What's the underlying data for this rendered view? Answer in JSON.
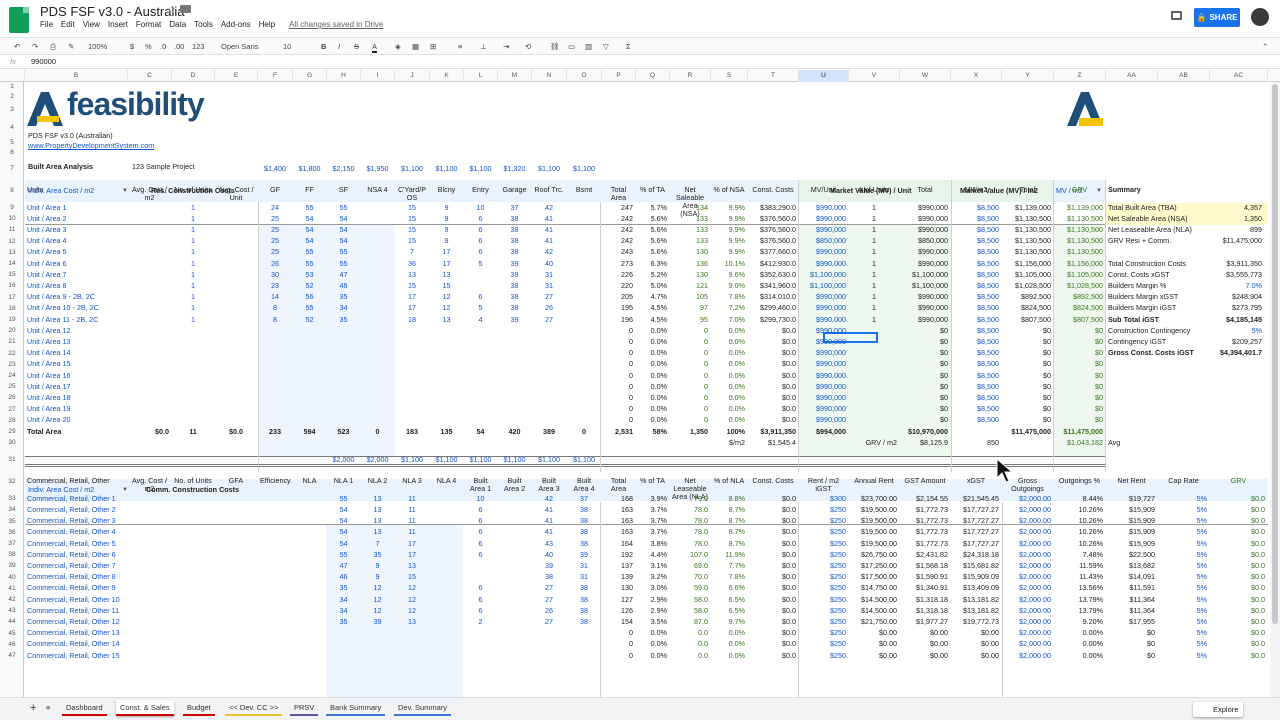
{
  "app": {
    "title": "PDS FSF v3.0 - Australia",
    "saved": "All changes saved in Drive",
    "share": "SHARE",
    "menus": [
      "File",
      "Edit",
      "View",
      "Insert",
      "Format",
      "Data",
      "Tools",
      "Add-ons",
      "Help"
    ]
  },
  "toolbar": {
    "zoom": "100%",
    "currency": "$",
    "percent": "%",
    "dec0": ".0",
    "dec00": ".00",
    "fmt": "123",
    "font": "Open Sans",
    "size": "10"
  },
  "formula": {
    "fx": "fx",
    "value": "990000"
  },
  "columns": [
    "",
    "B",
    "C",
    "D",
    "E",
    "F",
    "G",
    "H",
    "I",
    "J",
    "K",
    "L",
    "M",
    "N",
    "O",
    "P",
    "Q",
    "R",
    "S",
    "T",
    "U",
    "V",
    "W",
    "X",
    "Y",
    "Z",
    "AA",
    "AB",
    "AC"
  ],
  "rows": [
    "1",
    "2",
    "3",
    "4",
    "5",
    "6",
    "7",
    "8",
    "9",
    "10",
    "11",
    "12",
    "13",
    "14",
    "15",
    "16",
    "17",
    "18",
    "19",
    "20",
    "21",
    "22",
    "23",
    "24",
    "25",
    "26",
    "27",
    "28",
    "29",
    "30",
    "31",
    "32",
    "33",
    "34",
    "35",
    "36",
    "37",
    "38",
    "39",
    "40",
    "41",
    "42",
    "43",
    "44",
    "45",
    "46",
    "47"
  ],
  "header": {
    "logo_text": "feasibility",
    "subtitle": "PDS FSF v3.0 (Australian)",
    "link": "www.PropertyDevelopmentSystem.com",
    "analysis": "Built Area Analysis",
    "project": "123 Sample Project"
  },
  "row7": {
    "indiv": "Indiv. Area Cost / m2",
    "res": "Res. Construction Costs",
    "rates": [
      "$1,400",
      "$1,800",
      "$2,150",
      "$1,950",
      "$1,100",
      "$1,100",
      "$1,100",
      "$1,320",
      "$1,100",
      "$1,100"
    ],
    "mvunit": "Market Value (MV) / Unit",
    "mvm2": "Market Value (MV) / m2",
    "mvm2b": "MV / m2"
  },
  "row8": [
    "Units",
    "Avg. Cost / m2",
    "No. of Units",
    "Avg. Cost / Unit",
    "GF",
    "FF",
    "SF",
    "NSA 4",
    "C'Yard/P OS",
    "Blcny",
    "Entry",
    "Garage",
    "Roof Trc.",
    "Bsmt",
    "Total Area",
    "% of TA",
    "Net Saleable Area (NSA)",
    "% of NSA",
    "Const. Costs",
    "MV/Unit",
    "# of Units",
    "Total",
    "MV/m2",
    "Total",
    "GRV",
    "Summary"
  ],
  "units": [
    [
      "Unit / Area 1",
      "1",
      "24",
      "55",
      "55",
      "",
      "15",
      "9",
      "10",
      "37",
      "42",
      "",
      "247",
      "5.7%",
      "134",
      "9.9%",
      "$383,290.0",
      "$990,000",
      "1",
      "$990,000",
      "$8,500",
      "$1,139,000",
      "$1,139,000"
    ],
    [
      "Unit / Area 2",
      "1",
      "25",
      "54",
      "54",
      "",
      "15",
      "9",
      "6",
      "38",
      "41",
      "",
      "242",
      "5.6%",
      "133",
      "9.9%",
      "$376,560.0",
      "$990,000",
      "1",
      "$990,000",
      "$8,500",
      "$1,130,500",
      "$1,130,500"
    ],
    [
      "Unit / Area 3",
      "1",
      "25",
      "54",
      "54",
      "",
      "15",
      "9",
      "6",
      "38",
      "41",
      "",
      "242",
      "5.6%",
      "133",
      "9.9%",
      "$376,560.0",
      "$990,000",
      "1",
      "$990,000",
      "$8,500",
      "$1,130,500",
      "$1,130,500"
    ],
    [
      "Unit / Area 4",
      "1",
      "25",
      "54",
      "54",
      "",
      "15",
      "9",
      "6",
      "38",
      "41",
      "",
      "242",
      "5.6%",
      "133",
      "9.9%",
      "$376,560.0",
      "$850,000",
      "1",
      "$850,000",
      "$8,500",
      "$1,130,500",
      "$1,130,500"
    ],
    [
      "Unit / Area 5",
      "1",
      "25",
      "55",
      "55",
      "",
      "7",
      "17",
      "6",
      "38",
      "42",
      "",
      "243",
      "5.6%",
      "130",
      "9.9%",
      "$377,660.0",
      "$990,000",
      "1",
      "$990,000",
      "$8,500",
      "$1,130,500",
      "$1,130,500"
    ],
    [
      "Unit / Area 6",
      "1",
      "26",
      "55",
      "55",
      "",
      "36",
      "17",
      "5",
      "39",
      "40",
      "",
      "273",
      "6.3%",
      "136",
      "10.1%",
      "$412,930.0",
      "$990,000",
      "1",
      "$990,000",
      "$8,500",
      "$1,156,000",
      "$1,156,000"
    ],
    [
      "Unit / Area 7",
      "1",
      "30",
      "53",
      "47",
      "",
      "13",
      "13",
      "",
      "39",
      "31",
      "",
      "226",
      "5.2%",
      "130",
      "9.6%",
      "$352,630.0",
      "$1,100,000",
      "1",
      "$1,100,000",
      "$8,500",
      "$1,105,000",
      "$1,105,000"
    ],
    [
      "Unit / Area 8",
      "1",
      "23",
      "52",
      "46",
      "",
      "15",
      "15",
      "",
      "38",
      "31",
      "",
      "220",
      "5.0%",
      "121",
      "9.0%",
      "$341,960.0",
      "$1,100,000",
      "1",
      "$1,100,000",
      "$8,500",
      "$1,028,500",
      "$1,028,500"
    ],
    [
      "Unit / Area 9 - 2B, 2C",
      "1",
      "14",
      "56",
      "35",
      "",
      "17",
      "12",
      "6",
      "38",
      "27",
      "",
      "205",
      "4.7%",
      "105",
      "7.8%",
      "$314,010.0",
      "$990,000",
      "1",
      "$990,000",
      "$8,500",
      "$892,500",
      "$892,500"
    ],
    [
      "Unit / Area 10 - 2B, 2C",
      "1",
      "8",
      "55",
      "34",
      "",
      "17",
      "12",
      "5",
      "38",
      "26",
      "",
      "195",
      "4.5%",
      "97",
      "7.2%",
      "$299,460.0",
      "$990,000",
      "1",
      "$990,000",
      "$8,500",
      "$824,500",
      "$824,500"
    ],
    [
      "Unit / Area 11 - 2B, 2C",
      "1",
      "8",
      "52",
      "35",
      "",
      "18",
      "13",
      "4",
      "39",
      "27",
      "",
      "196",
      "4.5%",
      "95",
      "7.0%",
      "$299,730.0",
      "$990,000",
      "1",
      "$990,000",
      "$8,500",
      "$807,500",
      "$807,500"
    ]
  ],
  "empty_units": [
    "Unit / Area 12",
    "Unit / Area 13",
    "Unit / Area 14",
    "Unit / Area 15",
    "Unit / Area 16",
    "Unit / Area 17",
    "Unit / Area 18",
    "Unit / Area 19",
    "Unit / Area 20"
  ],
  "empty_vals": {
    "ta": "0",
    "pct": "0.0%",
    "nsa": "0",
    "pnsa": "0.0%",
    "cc": "$0.0",
    "mv": "$990,000",
    "tot": "$0",
    "mvm2": "$8,500",
    "tot2": "$0",
    "grv": "$0"
  },
  "summary": [
    [
      "Total Built Area (TBA)",
      "4,357"
    ],
    [
      "Net Saleable Area (NSA)",
      "1,350"
    ],
    [
      "Net Leaseable Area (NLA)",
      "899"
    ],
    [
      "GRV Resi + Comm.",
      "$11,475,000"
    ],
    [
      "",
      ""
    ],
    [
      "Total Construction Costs",
      "$3,911,350"
    ],
    [
      "Const. Costs xGST",
      "$3,555,773"
    ],
    [
      "Builders Margin %",
      "7.0%"
    ],
    [
      "Builders Margin xGST",
      "$248,904"
    ],
    [
      "Builders Margin iGST",
      "$273,795"
    ],
    [
      "Sub Total iGST",
      "$4,185,145"
    ],
    [
      "Construction Contingency",
      "5%"
    ],
    [
      "Contingency iGST",
      "$209,257"
    ],
    [
      "Gross Const. Costs iGST",
      "$4,394,401.7"
    ]
  ],
  "totals": [
    "Total Area",
    "$0.0",
    "11",
    "$0.0",
    "233",
    "594",
    "523",
    "0",
    "183",
    "135",
    "54",
    "420",
    "389",
    "0",
    "2,531",
    "58%",
    "1,350",
    "100%",
    "$3,911,350",
    "$994,000",
    "",
    "$10,970,000",
    "",
    "$11,475,000",
    "$11,475,000"
  ],
  "row30": {
    "m2": "$/m2",
    "cpm": "$1,545.4",
    "grvm2": "GRV / m2",
    "grvm2val": "$8,125.9",
    "n850": "850",
    "grv2": "$1,043,182",
    "avg": "Avg"
  },
  "row31": {
    "indiv": "Indiv. Area Cost / m2",
    "comm": "Comm. Construction Costs",
    "rates": [
      "$2,000",
      "$2,000",
      "$1,100",
      "$1,100",
      "$1,100",
      "$1,100",
      "$1,100",
      "$1,100"
    ]
  },
  "row32": [
    "Commercial, Retail, Other",
    "Avg. Cost / m2",
    "No. of Units",
    "GFA",
    "Efficiency",
    "NLA",
    "NLA 1",
    "NLA 2",
    "NLA 3",
    "NLA 4",
    "Built Area 1",
    "Built Area 2",
    "Built Area 3",
    "Built Area 4",
    "Total Area",
    "% of TA",
    "Net Leaseable Area (NLA)",
    "% of NLA",
    "Const. Costs",
    "Rent / m2 iGST",
    "Annual Rent",
    "GST Amount",
    "xGST",
    "Gross Outgoings",
    "Outgoings %",
    "Net Rent",
    "Cap Rate",
    "GRV"
  ],
  "comm": [
    [
      "Commercial, Retail, Other 1",
      "55",
      "13",
      "11",
      "10",
      "",
      "42",
      "37",
      "168",
      "3.9%",
      "79.0",
      "8.8%",
      "$0.0",
      "$300",
      "$23,700.00",
      "$2,154.55",
      "$21,545.45",
      "$2,000.00",
      "8.44%",
      "$19,727",
      "5%",
      "$0.0"
    ],
    [
      "Commercial, Retail, Other 2",
      "54",
      "13",
      "11",
      "6",
      "",
      "41",
      "38",
      "163",
      "3.7%",
      "78.0",
      "8.7%",
      "$0.0",
      "$250",
      "$19,500.00",
      "$1,772.73",
      "$17,727.27",
      "$2,000.00",
      "10.26%",
      "$15,909",
      "5%",
      "$0.0"
    ],
    [
      "Commercial, Retail, Other 3",
      "54",
      "13",
      "11",
      "6",
      "",
      "41",
      "38",
      "163",
      "3.7%",
      "78.0",
      "8.7%",
      "$0.0",
      "$250",
      "$19,500.00",
      "$1,772.73",
      "$17,727.27",
      "$2,000.00",
      "10.26%",
      "$15,909",
      "5%",
      "$0.0"
    ],
    [
      "Commercial, Retail, Other 4",
      "54",
      "13",
      "11",
      "6",
      "",
      "41",
      "38",
      "163",
      "3.7%",
      "78.0",
      "8.7%",
      "$0.0",
      "$250",
      "$19,500.00",
      "$1,772.73",
      "$17,727.27",
      "$2,000.00",
      "10.26%",
      "$15,909",
      "5%",
      "$0.0"
    ],
    [
      "Commercial, Retail, Other 5",
      "54",
      "7",
      "17",
      "6",
      "",
      "43",
      "38",
      "164",
      "3.8%",
      "78.0",
      "8.7%",
      "$0.0",
      "$250",
      "$19,500.00",
      "$1,772.73",
      "$17,727.27",
      "$2,000.00",
      "10.26%",
      "$15,909",
      "5%",
      "$0.0"
    ],
    [
      "Commercial, Retail, Other 6",
      "55",
      "35",
      "17",
      "6",
      "",
      "40",
      "39",
      "192",
      "4.4%",
      "107.0",
      "11.9%",
      "$0.0",
      "$250",
      "$26,750.00",
      "$2,431.82",
      "$24,318.18",
      "$2,000.00",
      "7.48%",
      "$22,500",
      "5%",
      "$0.0"
    ],
    [
      "Commercial, Retail, Other 7",
      "47",
      "9",
      "13",
      "",
      "",
      "39",
      "31",
      "137",
      "3.1%",
      "69.0",
      "7.7%",
      "$0.0",
      "$250",
      "$17,250.00",
      "$1,568.18",
      "$15,681.82",
      "$2,000.00",
      "11.59%",
      "$13,682",
      "5%",
      "$0.0"
    ],
    [
      "Commercial, Retail, Other 8",
      "46",
      "9",
      "15",
      "",
      "",
      "38",
      "31",
      "139",
      "3.2%",
      "70.0",
      "7.8%",
      "$0.0",
      "$250",
      "$17,500.00",
      "$1,590.91",
      "$15,909.09",
      "$2,000.00",
      "11.43%",
      "$14,091",
      "5%",
      "$0.0"
    ],
    [
      "Commercial, Retail, Other 9",
      "35",
      "12",
      "12",
      "6",
      "",
      "27",
      "38",
      "130",
      "3.0%",
      "59.0",
      "6.6%",
      "$0.0",
      "$250",
      "$14,750.00",
      "$1,340.91",
      "$13,409.09",
      "$2,000.00",
      "13.56%",
      "$11,591",
      "5%",
      "$0.0"
    ],
    [
      "Commercial, Retail, Other 10",
      "34",
      "12",
      "12",
      "6",
      "",
      "27",
      "38",
      "127",
      "2.9%",
      "58.0",
      "6.5%",
      "$0.0",
      "$250",
      "$14,500.00",
      "$1,318.18",
      "$13,181.82",
      "$2,000.00",
      "13.79%",
      "$11,364",
      "5%",
      "$0.0"
    ],
    [
      "Commercial, Retail, Other 11",
      "34",
      "12",
      "12",
      "6",
      "",
      "26",
      "38",
      "126",
      "2.9%",
      "58.0",
      "6.5%",
      "$0.0",
      "$250",
      "$14,500.00",
      "$1,318.18",
      "$13,181.82",
      "$2,000.00",
      "13.79%",
      "$11,364",
      "5%",
      "$0.0"
    ],
    [
      "Commercial, Retail, Other 12",
      "35",
      "39",
      "13",
      "2",
      "",
      "27",
      "38",
      "154",
      "3.5%",
      "87.0",
      "9.7%",
      "$0.0",
      "$250",
      "$21,750.00",
      "$1,977.27",
      "$19,772.73",
      "$2,000.00",
      "9.20%",
      "$17,955",
      "5%",
      "$0.0"
    ],
    [
      "Commercial, Retail, Other 13",
      "",
      "",
      "",
      "",
      "",
      "",
      "",
      "0",
      "0.0%",
      "0.0",
      "0.0%",
      "$0.0",
      "$250",
      "$0.00",
      "$0.00",
      "$0.00",
      "$2,000.00",
      "0.00%",
      "$0",
      "5%",
      "$0.0"
    ],
    [
      "Commercial, Retail, Other 14",
      "",
      "",
      "",
      "",
      "",
      "",
      "",
      "0",
      "0.0%",
      "0.0",
      "0.0%",
      "$0.0",
      "$250",
      "$0.00",
      "$0.00",
      "$0.00",
      "$2,000.00",
      "0.00%",
      "$0",
      "5%",
      "$0.0"
    ],
    [
      "Commercial, Retail, Other 15",
      "",
      "",
      "",
      "",
      "",
      "",
      "",
      "0",
      "0.0%",
      "0.0",
      "0.0%",
      "$0.0",
      "$250",
      "$0.00",
      "$0.00",
      "$0.00",
      "$2,000.00",
      "0.00%",
      "$0",
      "5%",
      "$0.0"
    ]
  ],
  "sheets": [
    "Dashboard",
    "Const. & Sales",
    "Budget",
    "<< Dev. CC >>",
    "PRSV",
    "Bank Summary",
    "Dev. Summary"
  ],
  "explore": "Explore"
}
